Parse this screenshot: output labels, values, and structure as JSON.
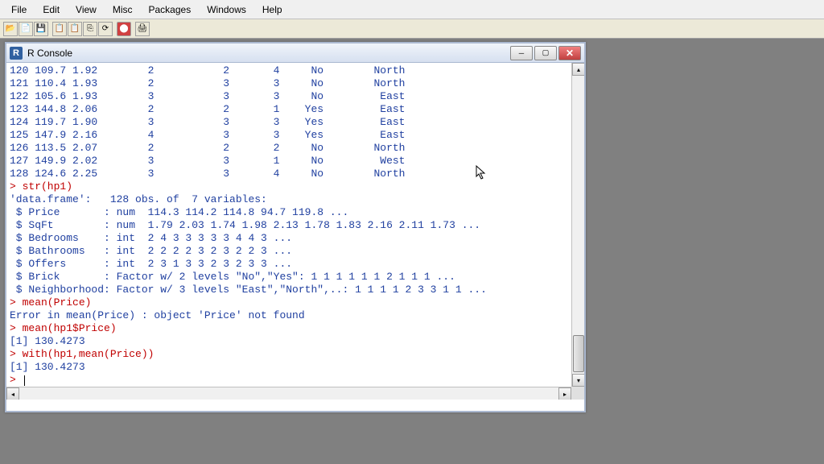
{
  "menubar": {
    "items": [
      "File",
      "Edit",
      "View",
      "Misc",
      "Packages",
      "Windows",
      "Help"
    ]
  },
  "window": {
    "title": "R Console",
    "icon_letter": "R"
  },
  "console": {
    "data_rows": [
      {
        "i": "120",
        "price": "109.7",
        "sqft": "1.92",
        "bed": "2",
        "bath": "2",
        "offers": "4",
        "brick": "No",
        "nbhd": "North"
      },
      {
        "i": "121",
        "price": "110.4",
        "sqft": "1.93",
        "bed": "2",
        "bath": "3",
        "offers": "3",
        "brick": "No",
        "nbhd": "North"
      },
      {
        "i": "122",
        "price": "105.6",
        "sqft": "1.93",
        "bed": "3",
        "bath": "3",
        "offers": "3",
        "brick": "No",
        "nbhd": "East"
      },
      {
        "i": "123",
        "price": "144.8",
        "sqft": "2.06",
        "bed": "2",
        "bath": "2",
        "offers": "1",
        "brick": "Yes",
        "nbhd": "East"
      },
      {
        "i": "124",
        "price": "119.7",
        "sqft": "1.90",
        "bed": "3",
        "bath": "3",
        "offers": "3",
        "brick": "Yes",
        "nbhd": "East"
      },
      {
        "i": "125",
        "price": "147.9",
        "sqft": "2.16",
        "bed": "4",
        "bath": "3",
        "offers": "3",
        "brick": "Yes",
        "nbhd": "East"
      },
      {
        "i": "126",
        "price": "113.5",
        "sqft": "2.07",
        "bed": "2",
        "bath": "2",
        "offers": "2",
        "brick": "No",
        "nbhd": "North"
      },
      {
        "i": "127",
        "price": "149.9",
        "sqft": "2.02",
        "bed": "3",
        "bath": "3",
        "offers": "1",
        "brick": "No",
        "nbhd": "West"
      },
      {
        "i": "128",
        "price": "124.6",
        "sqft": "2.25",
        "bed": "3",
        "bath": "3",
        "offers": "4",
        "brick": "No",
        "nbhd": "North"
      }
    ],
    "cmd_str": "> str(hp1)",
    "str_header": "'data.frame':   128 obs. of  7 variables:",
    "str_lines": [
      " $ Price       : num  114.3 114.2 114.8 94.7 119.8 ...",
      " $ SqFt        : num  1.79 2.03 1.74 1.98 2.13 1.78 1.83 2.16 2.11 1.73 ...",
      " $ Bedrooms    : int  2 4 3 3 3 3 3 4 4 3 ...",
      " $ Bathrooms   : int  2 2 2 2 3 2 3 2 2 3 ...",
      " $ Offers      : int  2 3 1 3 3 2 3 2 3 3 ...",
      " $ Brick       : Factor w/ 2 levels \"No\",\"Yes\": 1 1 1 1 1 1 2 1 1 1 ...",
      " $ Neighborhood: Factor w/ 3 levels \"East\",\"North\",..: 1 1 1 1 2 3 3 1 1 ..."
    ],
    "cmd_mean1": "> mean(Price)",
    "error_line": "Error in mean(Price) : object 'Price' not found",
    "cmd_mean2": "> mean(hp1$Price)",
    "result1": "[1] 130.4273",
    "cmd_with": "> with(hp1,mean(Price))",
    "result2": "[1] 130.4273",
    "prompt": "> "
  }
}
